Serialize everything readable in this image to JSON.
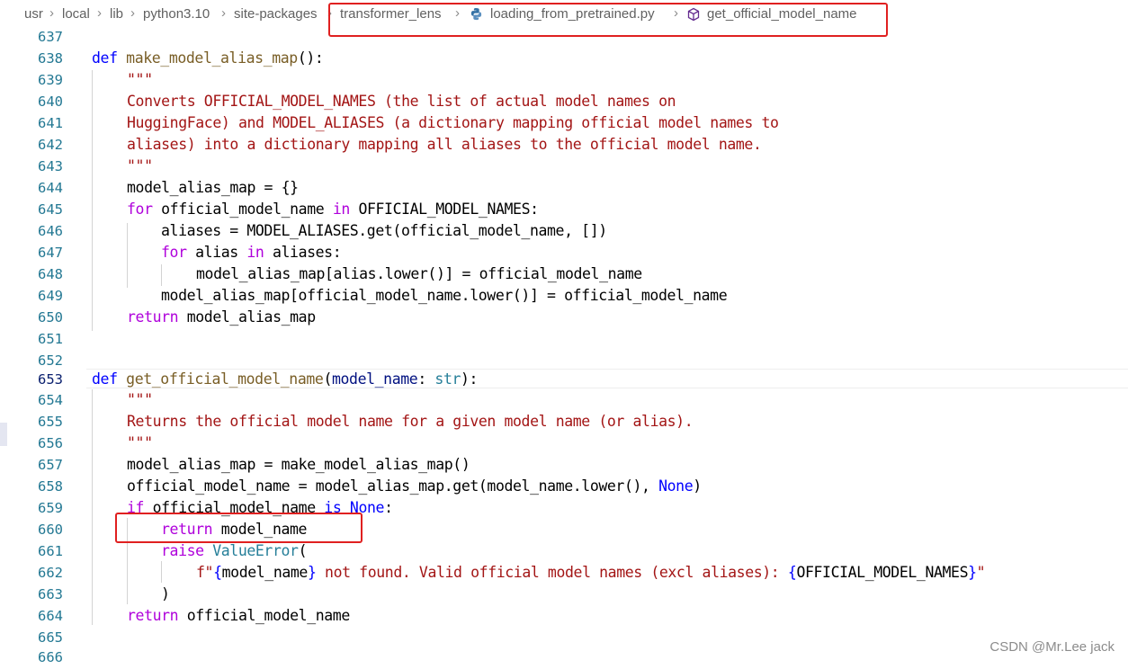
{
  "breadcrumb": {
    "items": [
      "usr",
      "local",
      "lib",
      "python3.10",
      "site-packages",
      "transformer_lens",
      "loading_from_pretrained.py",
      "get_official_model_name"
    ],
    "separator": ">"
  },
  "lines": {
    "637": "637",
    "638": "638",
    "639": "639",
    "640": "640",
    "641": "641",
    "642": "642",
    "643": "643",
    "644": "644",
    "645": "645",
    "646": "646",
    "647": "647",
    "648": "648",
    "649": "649",
    "650": "650",
    "651": "651",
    "652": "652",
    "653": "653",
    "654": "654",
    "655": "655",
    "656": "656",
    "657": "657",
    "658": "658",
    "659": "659",
    "660": "660",
    "661": "661",
    "662": "662",
    "663": "663",
    "664": "664",
    "665": "665",
    "666": "666"
  },
  "code": {
    "l638": {
      "def": "def",
      "fn": "make_model_alias_map",
      "rest": "():"
    },
    "l639": "\"\"\"",
    "l640": "Converts OFFICIAL_MODEL_NAMES (the list of actual model names on",
    "l641": "HuggingFace) and MODEL_ALIASES (a dictionary mapping official model names to",
    "l642": "aliases) into a dictionary mapping all aliases to the official model name.",
    "l643": "\"\"\"",
    "l644": "model_alias_map = {}",
    "l645": {
      "for": "for",
      "a": " official_model_name ",
      "in": "in",
      "b": " OFFICIAL_MODEL_NAMES:"
    },
    "l646": "aliases = MODEL_ALIASES.get(official_model_name, [])",
    "l647": {
      "for": "for",
      "a": " alias ",
      "in": "in",
      "b": " aliases:"
    },
    "l648": "model_alias_map[alias.lower()] = official_model_name",
    "l649": "model_alias_map[official_model_name.lower()] = official_model_name",
    "l650": {
      "return": "return",
      "rest": " model_alias_map"
    },
    "l653": {
      "def": "def",
      "fn": "get_official_model_name",
      "p1": "(",
      "param": "model_name",
      "colon": ": ",
      "type": "str",
      "p2": "):"
    },
    "l654": "\"\"\"",
    "l655": "Returns the official model name for a given model name (or alias).",
    "l656": "\"\"\"",
    "l657": "model_alias_map = make_model_alias_map()",
    "l658": {
      "a": "official_model_name = model_alias_map.get(model_name.lower(), ",
      "none": "None",
      "b": ")"
    },
    "l659": {
      "if": "if",
      "a": " official_model_name ",
      "is": "is",
      "sp": " ",
      "none": "None",
      "b": ":"
    },
    "l660": {
      "return": "return",
      "rest": " model_name"
    },
    "l661": {
      "raise": "raise",
      "sp": " ",
      "cls": "ValueError",
      "rest": "("
    },
    "l662": {
      "f": "f\"",
      "o1": "{",
      "v1": "model_name",
      "c1": "}",
      "mid": " not found. Valid official model names (excl aliases): ",
      "o2": "{",
      "v2": "OFFICIAL_MODEL_NAMES",
      "c2": "}",
      "end": "\""
    },
    "l663": ")",
    "l664": {
      "return": "return",
      "rest": " official_model_name"
    }
  },
  "watermark": "CSDN @Mr.Lee jack",
  "colors": {
    "keyword": "#0000ff",
    "control": "#af00db",
    "function": "#795e26",
    "string": "#a31515",
    "variable": "#001080",
    "type": "#267f99",
    "line_number": "#237893",
    "annotation_box": "#e02020"
  },
  "icons": [
    "chevron-right-icon",
    "python-file-icon",
    "method-cube-icon"
  ]
}
